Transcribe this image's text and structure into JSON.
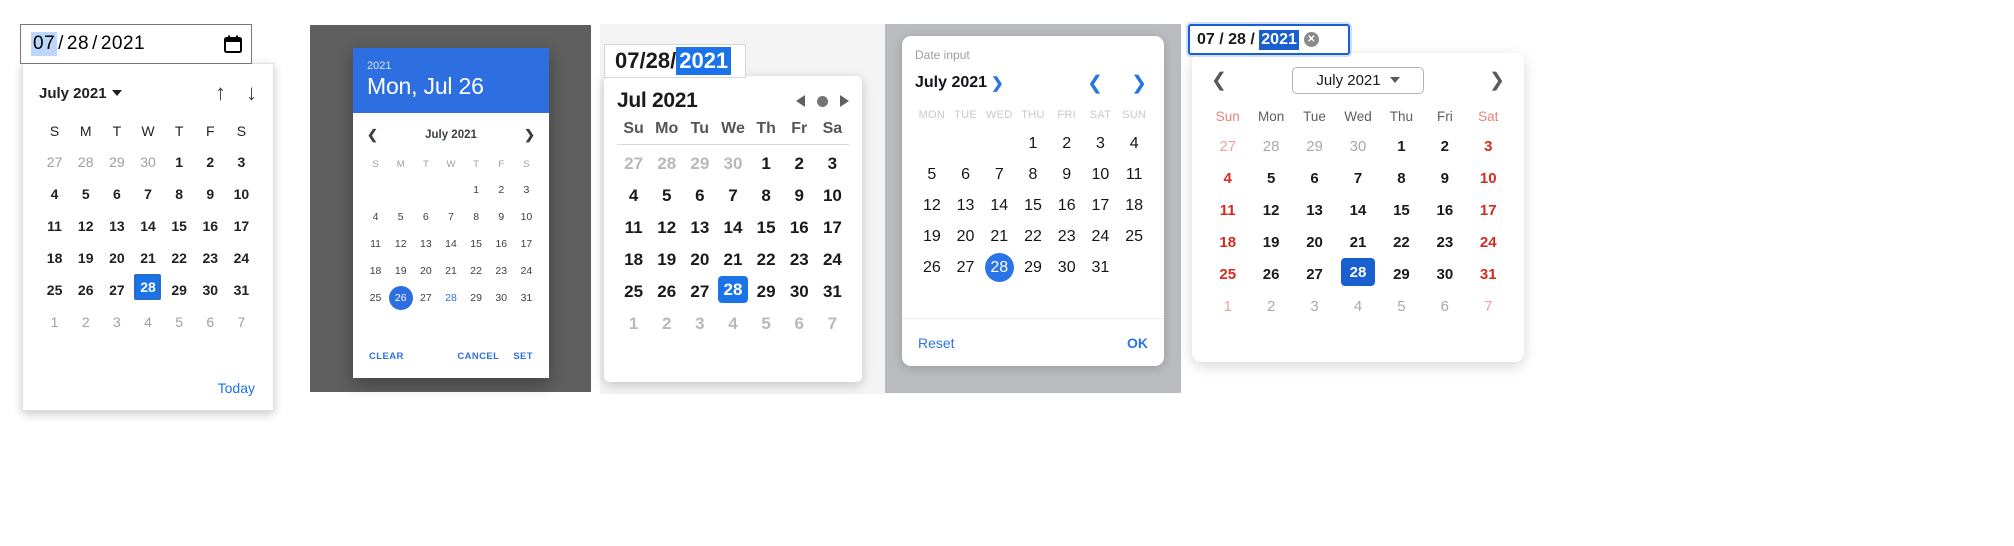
{
  "chrome": {
    "name": "chrome-date-picker",
    "input": {
      "month": "07",
      "day": "28",
      "year": "2021",
      "slash": "/",
      "icon": "calendar-icon"
    },
    "header": {
      "month_label": "July 2021",
      "caret": "▾",
      "prev_icon": "↑",
      "next_icon": "↓"
    },
    "dow": [
      "S",
      "M",
      "T",
      "W",
      "T",
      "F",
      "S"
    ],
    "weeks": [
      [
        {
          "d": "27",
          "o": true
        },
        {
          "d": "28",
          "o": true
        },
        {
          "d": "29",
          "o": true
        },
        {
          "d": "30",
          "o": true
        },
        {
          "d": "1"
        },
        {
          "d": "2"
        },
        {
          "d": "3"
        }
      ],
      [
        {
          "d": "4"
        },
        {
          "d": "5"
        },
        {
          "d": "6"
        },
        {
          "d": "7"
        },
        {
          "d": "8"
        },
        {
          "d": "9"
        },
        {
          "d": "10"
        }
      ],
      [
        {
          "d": "11"
        },
        {
          "d": "12"
        },
        {
          "d": "13"
        },
        {
          "d": "14"
        },
        {
          "d": "15"
        },
        {
          "d": "16"
        },
        {
          "d": "17"
        }
      ],
      [
        {
          "d": "18"
        },
        {
          "d": "19"
        },
        {
          "d": "20"
        },
        {
          "d": "21"
        },
        {
          "d": "22"
        },
        {
          "d": "23"
        },
        {
          "d": "24"
        }
      ],
      [
        {
          "d": "25"
        },
        {
          "d": "26"
        },
        {
          "d": "27"
        },
        {
          "d": "28",
          "s": true
        },
        {
          "d": "29"
        },
        {
          "d": "30"
        },
        {
          "d": "31"
        }
      ],
      [
        {
          "d": "1",
          "o": true
        },
        {
          "d": "2",
          "o": true
        },
        {
          "d": "3",
          "o": true
        },
        {
          "d": "4",
          "o": true
        },
        {
          "d": "5",
          "o": true
        },
        {
          "d": "6",
          "o": true
        },
        {
          "d": "7",
          "o": true
        }
      ]
    ],
    "today_label": "Today",
    "accent": "#1a73e8"
  },
  "material": {
    "name": "material-date-picker",
    "header": {
      "year": "2021",
      "date": "Mon, Jul 26"
    },
    "nav": {
      "prev_icon": "❮",
      "next_icon": "❯",
      "month_label": "July 2021"
    },
    "dow": [
      "S",
      "M",
      "T",
      "W",
      "T",
      "F",
      "S"
    ],
    "weeks": [
      [
        {
          "d": ""
        },
        {
          "d": ""
        },
        {
          "d": ""
        },
        {
          "d": ""
        },
        {
          "d": "1"
        },
        {
          "d": "2"
        },
        {
          "d": "3"
        }
      ],
      [
        {
          "d": "4"
        },
        {
          "d": "5"
        },
        {
          "d": "6"
        },
        {
          "d": "7"
        },
        {
          "d": "8"
        },
        {
          "d": "9"
        },
        {
          "d": "10"
        }
      ],
      [
        {
          "d": "11"
        },
        {
          "d": "12"
        },
        {
          "d": "13"
        },
        {
          "d": "14"
        },
        {
          "d": "15"
        },
        {
          "d": "16"
        },
        {
          "d": "17"
        }
      ],
      [
        {
          "d": "18"
        },
        {
          "d": "19"
        },
        {
          "d": "20"
        },
        {
          "d": "21"
        },
        {
          "d": "22"
        },
        {
          "d": "23"
        },
        {
          "d": "24"
        }
      ],
      [
        {
          "d": "25"
        },
        {
          "d": "26",
          "s": true
        },
        {
          "d": "27"
        },
        {
          "d": "28",
          "t": true
        },
        {
          "d": "29"
        },
        {
          "d": "30"
        },
        {
          "d": "31"
        }
      ]
    ],
    "actions": {
      "clear": "CLEAR",
      "cancel": "CANCEL",
      "set": "SET"
    },
    "accent": "#2d6fe0",
    "scrim": "#5f5f5f"
  },
  "safari": {
    "name": "safari-date-picker",
    "input": {
      "month": "07",
      "day": "28",
      "year": "2021",
      "slash": "/"
    },
    "header": {
      "month_label": "Jul 2021",
      "prev_icon": "◀",
      "stop_icon": "●",
      "next_icon": "▶"
    },
    "dow": [
      "Su",
      "Mo",
      "Tu",
      "We",
      "Th",
      "Fr",
      "Sa"
    ],
    "weeks": [
      [
        {
          "d": "27",
          "o": true
        },
        {
          "d": "28",
          "o": true
        },
        {
          "d": "29",
          "o": true
        },
        {
          "d": "30",
          "o": true
        },
        {
          "d": "1"
        },
        {
          "d": "2"
        },
        {
          "d": "3"
        }
      ],
      [
        {
          "d": "4"
        },
        {
          "d": "5"
        },
        {
          "d": "6"
        },
        {
          "d": "7"
        },
        {
          "d": "8"
        },
        {
          "d": "9"
        },
        {
          "d": "10"
        }
      ],
      [
        {
          "d": "11"
        },
        {
          "d": "12"
        },
        {
          "d": "13"
        },
        {
          "d": "14"
        },
        {
          "d": "15"
        },
        {
          "d": "16"
        },
        {
          "d": "17"
        }
      ],
      [
        {
          "d": "18"
        },
        {
          "d": "19"
        },
        {
          "d": "20"
        },
        {
          "d": "21"
        },
        {
          "d": "22"
        },
        {
          "d": "23"
        },
        {
          "d": "24"
        }
      ],
      [
        {
          "d": "25"
        },
        {
          "d": "26"
        },
        {
          "d": "27"
        },
        {
          "d": "28",
          "s": true
        },
        {
          "d": "29"
        },
        {
          "d": "30"
        },
        {
          "d": "31"
        }
      ],
      [
        {
          "d": "1",
          "o": true
        },
        {
          "d": "2",
          "o": true
        },
        {
          "d": "3",
          "o": true
        },
        {
          "d": "4",
          "o": true
        },
        {
          "d": "5",
          "o": true
        },
        {
          "d": "6",
          "o": true
        },
        {
          "d": "7",
          "o": true
        }
      ]
    ],
    "accent": "#1a73e8"
  },
  "firefox": {
    "name": "firefox-date-picker",
    "field_label": "Date input",
    "header": {
      "month_label": "July 2021",
      "month_chevron": "❯",
      "prev_icon": "❮",
      "next_icon": "❯"
    },
    "dow": [
      "MON",
      "TUE",
      "WED",
      "THU",
      "FRI",
      "SAT",
      "SUN"
    ],
    "weeks": [
      [
        {
          "d": ""
        },
        {
          "d": ""
        },
        {
          "d": ""
        },
        {
          "d": "1"
        },
        {
          "d": "2"
        },
        {
          "d": "3"
        },
        {
          "d": "4"
        }
      ],
      [
        {
          "d": "5"
        },
        {
          "d": "6"
        },
        {
          "d": "7"
        },
        {
          "d": "8"
        },
        {
          "d": "9"
        },
        {
          "d": "10"
        },
        {
          "d": "11"
        }
      ],
      [
        {
          "d": "12"
        },
        {
          "d": "13"
        },
        {
          "d": "14"
        },
        {
          "d": "15"
        },
        {
          "d": "16"
        },
        {
          "d": "17"
        },
        {
          "d": "18"
        }
      ],
      [
        {
          "d": "19"
        },
        {
          "d": "20"
        },
        {
          "d": "21"
        },
        {
          "d": "22"
        },
        {
          "d": "23"
        },
        {
          "d": "24"
        },
        {
          "d": "25"
        }
      ],
      [
        {
          "d": "26"
        },
        {
          "d": "27"
        },
        {
          "d": "28",
          "s": true
        },
        {
          "d": "29"
        },
        {
          "d": "30"
        },
        {
          "d": "31"
        },
        {
          "d": ""
        }
      ]
    ],
    "actions": {
      "reset": "Reset",
      "ok": "OK"
    },
    "accent": "#2b74e8",
    "scrim": "#b9bbbe"
  },
  "edge": {
    "name": "edge-date-picker",
    "input": {
      "month": "07",
      "day": "28",
      "year": "2021",
      "slash": " / ",
      "clear_icon": "✕"
    },
    "header": {
      "prev_icon": "❮",
      "month_label": "July 2021",
      "next_icon": "❯"
    },
    "dow": [
      "Sun",
      "Mon",
      "Tue",
      "Wed",
      "Thu",
      "Fri",
      "Sat"
    ],
    "weeks": [
      [
        {
          "d": "27",
          "o": true,
          "w": true
        },
        {
          "d": "28",
          "o": true
        },
        {
          "d": "29",
          "o": true
        },
        {
          "d": "30",
          "o": true
        },
        {
          "d": "1"
        },
        {
          "d": "2"
        },
        {
          "d": "3",
          "w": true
        }
      ],
      [
        {
          "d": "4",
          "w": true
        },
        {
          "d": "5"
        },
        {
          "d": "6"
        },
        {
          "d": "7"
        },
        {
          "d": "8"
        },
        {
          "d": "9"
        },
        {
          "d": "10",
          "w": true
        }
      ],
      [
        {
          "d": "11",
          "w": true
        },
        {
          "d": "12"
        },
        {
          "d": "13"
        },
        {
          "d": "14"
        },
        {
          "d": "15"
        },
        {
          "d": "16"
        },
        {
          "d": "17",
          "w": true
        }
      ],
      [
        {
          "d": "18",
          "w": true
        },
        {
          "d": "19"
        },
        {
          "d": "20"
        },
        {
          "d": "21"
        },
        {
          "d": "22"
        },
        {
          "d": "23"
        },
        {
          "d": "24",
          "w": true
        }
      ],
      [
        {
          "d": "25",
          "w": true
        },
        {
          "d": "26"
        },
        {
          "d": "27"
        },
        {
          "d": "28",
          "s": true
        },
        {
          "d": "29"
        },
        {
          "d": "30"
        },
        {
          "d": "31",
          "w": true
        }
      ],
      [
        {
          "d": "1",
          "o": true,
          "w": true
        },
        {
          "d": "2",
          "o": true
        },
        {
          "d": "3",
          "o": true
        },
        {
          "d": "4",
          "o": true
        },
        {
          "d": "5",
          "o": true
        },
        {
          "d": "6",
          "o": true
        },
        {
          "d": "7",
          "o": true,
          "w": true
        }
      ]
    ],
    "accent": "#1a5fd0",
    "weekend_color": "#d52b1e"
  }
}
